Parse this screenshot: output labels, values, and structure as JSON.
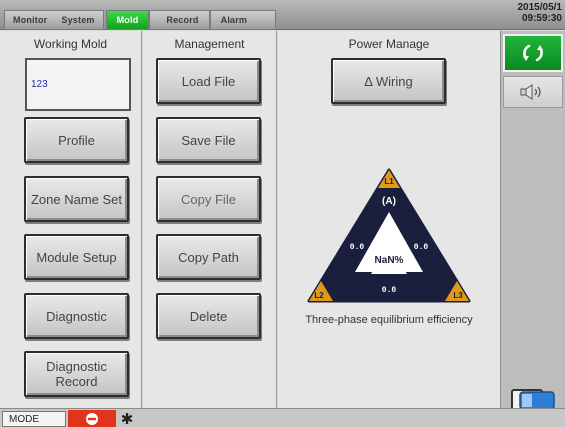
{
  "topbar": {
    "tabs": [
      {
        "label": "Monitor"
      },
      {
        "label": "System"
      },
      {
        "label": "Mold"
      },
      {
        "label": "Record"
      },
      {
        "label": "Alarm"
      }
    ],
    "active_tab": "Mold",
    "date": "2015/05/1",
    "time": "09:59:30"
  },
  "working_mold": {
    "title": "Working Mold",
    "mold_name": "123",
    "buttons": {
      "profile": "Profile",
      "zone_name_set": "Zone Name Set",
      "module_setup": "Module Setup",
      "diagnostic": "Diagnostic",
      "diagnostic_record": "Diagnostic Record"
    }
  },
  "management": {
    "title": "Management",
    "buttons": {
      "load_file": "Load File",
      "save_file": "Save File",
      "copy_file": "Copy File",
      "copy_path": "Copy Path",
      "delete": "Delete"
    }
  },
  "power_manage": {
    "title": "Power Manage",
    "wiring_button": "Δ Wiring",
    "triangle": {
      "corner_l1": "L1",
      "corner_l2": "L2",
      "corner_l3": "L3",
      "unit": "(A)",
      "value_left": "0.0",
      "value_right": "0.0",
      "value_bottom": "0.0",
      "center_value": "NaN%"
    },
    "caption": "Three-phase equilibrium efficiency"
  },
  "bottombar": {
    "mode_label": "MODE"
  },
  "icons": {
    "connection": "refresh-arrows-icon",
    "speaker": "speaker-icon",
    "stop": "stop-icon",
    "cooling": "snowflake-icon",
    "card": "memory-card-icon"
  },
  "colors": {
    "active_tab": "#14a824",
    "connection_button": "#109a2a",
    "triangle_body": "#1a1f3e",
    "triangle_corner": "#e09a1a",
    "stop_button": "#e2331f"
  }
}
